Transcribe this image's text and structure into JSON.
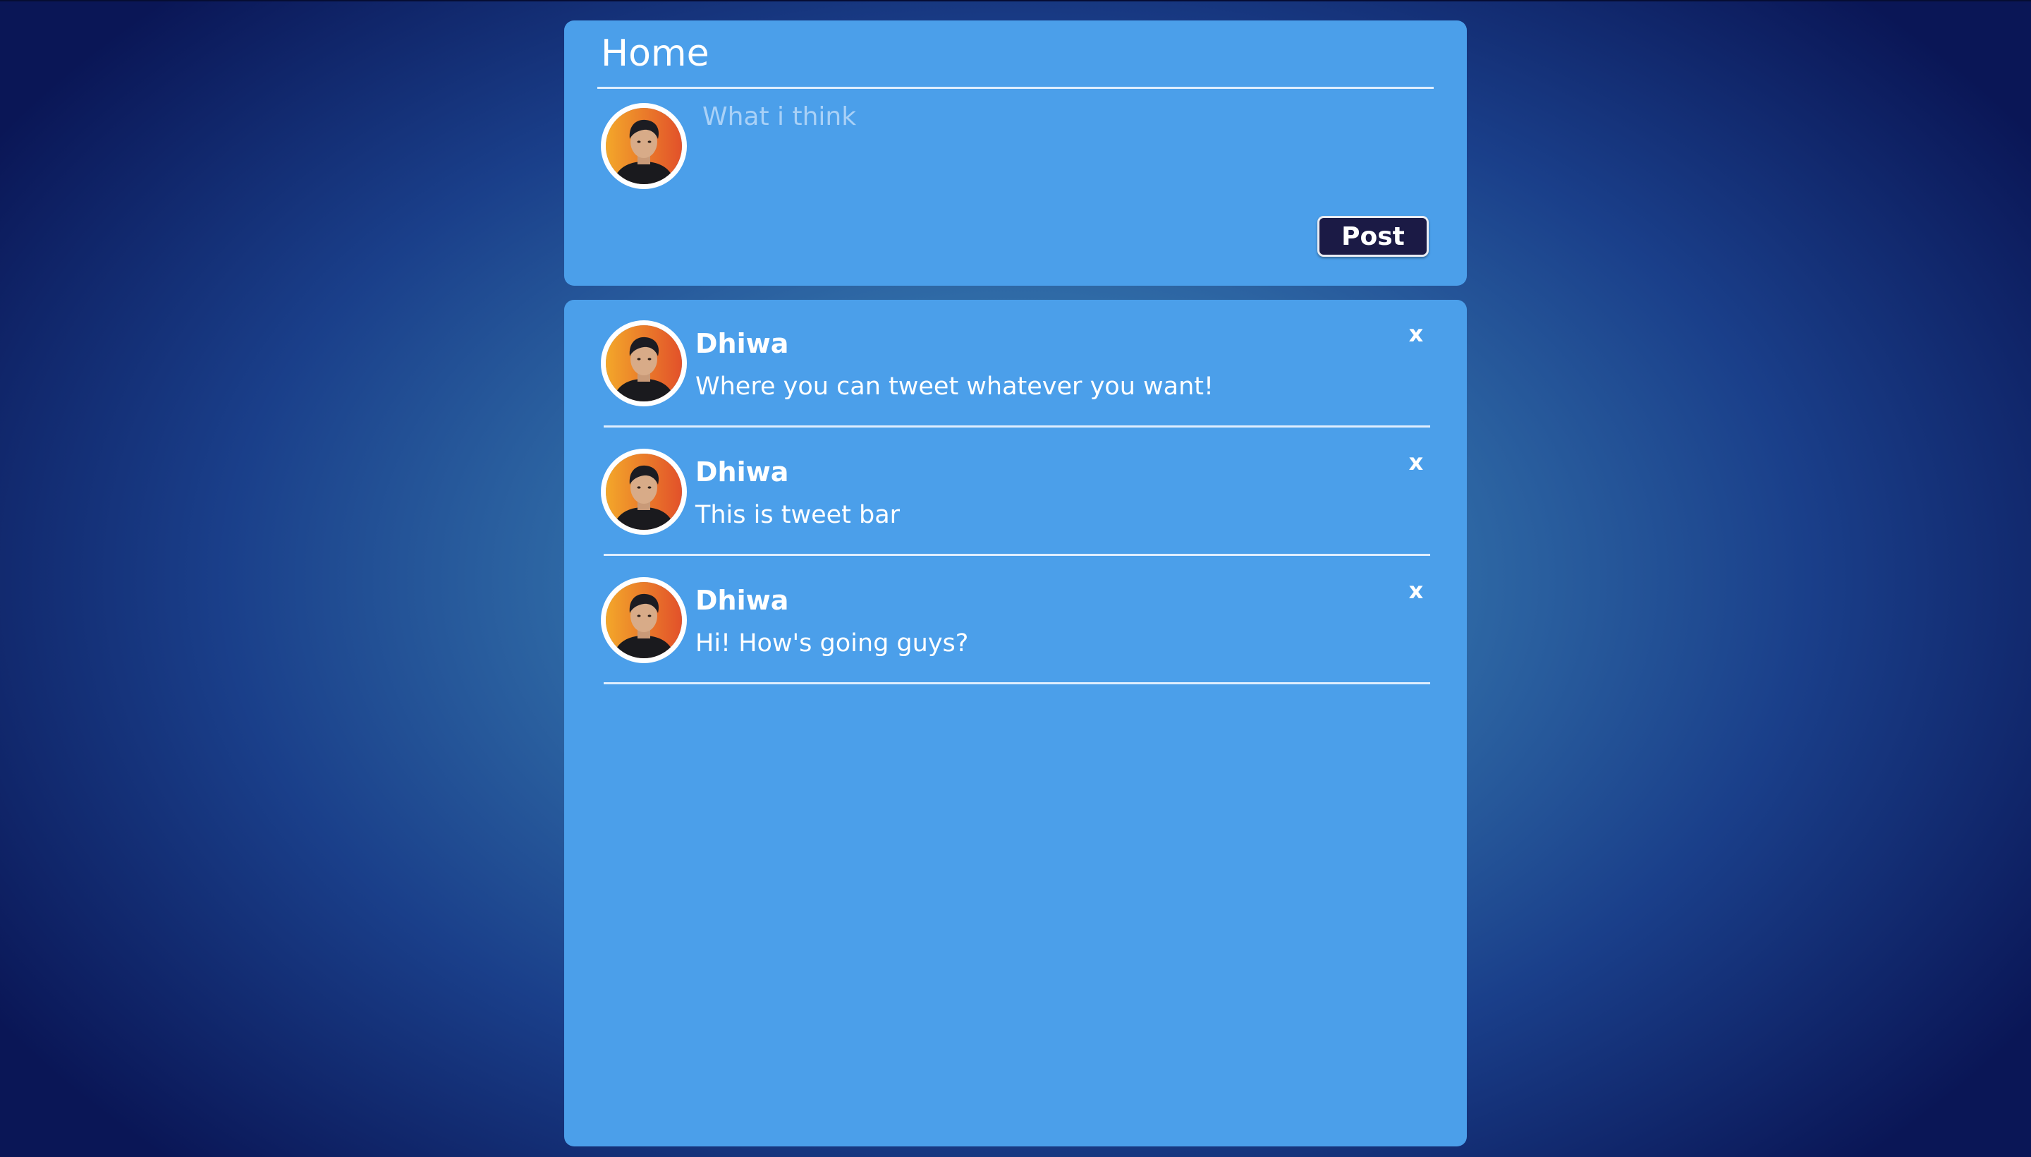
{
  "compose": {
    "title": "Home",
    "placeholder": "What i think",
    "post_label": "Post"
  },
  "feed": {
    "tweets": [
      {
        "name": "Dhiwa",
        "text": "Where you can tweet whatever you want!",
        "close": "x"
      },
      {
        "name": "Dhiwa",
        "text": "This is tweet bar",
        "close": "x"
      },
      {
        "name": "Dhiwa",
        "text": "Hi! How's going guys?",
        "close": "x"
      }
    ]
  },
  "icons": {
    "avatar": "user-avatar-photo",
    "close": "close-icon"
  },
  "colors": {
    "card": "#4b9fea",
    "button": "#1b1a45",
    "text": "#ffffff",
    "placeholder": "#a9d1f7"
  }
}
